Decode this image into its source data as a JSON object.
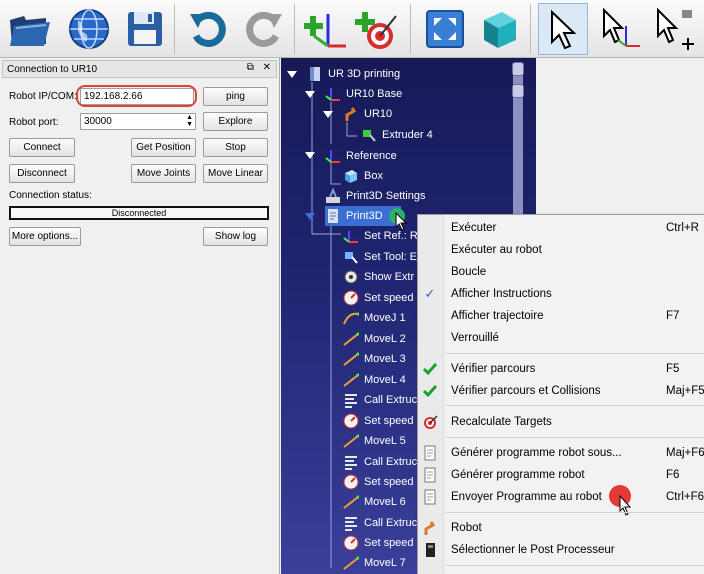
{
  "toolbar": {
    "buttons": [
      {
        "name": "open-icon"
      },
      {
        "name": "globe-icon"
      },
      {
        "name": "save-icon"
      },
      {
        "name": "undo-icon"
      },
      {
        "name": "redo-icon"
      },
      {
        "name": "add-reference-icon"
      },
      {
        "name": "add-target-icon"
      },
      {
        "name": "fit-all-icon"
      },
      {
        "name": "cube-view-icon"
      },
      {
        "name": "select-icon"
      },
      {
        "name": "move-reference-icon"
      },
      {
        "name": "move-tool-icon"
      }
    ]
  },
  "connection_panel": {
    "title": "Connection to UR10",
    "ip_label": "Robot IP/COM:",
    "ip_value": "192.168.2.66",
    "ping_label": "ping",
    "port_label": "Robot port:",
    "port_value": "30000",
    "explore_label": "Explore",
    "connect_label": "Connect",
    "get_position_label": "Get Position",
    "stop_label": "Stop",
    "disconnect_label": "Disconnect",
    "move_joints_label": "Move Joints",
    "move_linear_label": "Move Linear",
    "status_label": "Connection status:",
    "status_value": "Disconnected",
    "more_options_label": "More options...",
    "show_log_label": "Show log"
  },
  "tree": {
    "items": [
      {
        "label": "UR 3D printing"
      },
      {
        "label": "UR10 Base"
      },
      {
        "label": "UR10"
      },
      {
        "label": "Extruder 4"
      },
      {
        "label": "Reference"
      },
      {
        "label": "Box"
      },
      {
        "label": "Print3D Settings"
      },
      {
        "label": "Print3D"
      },
      {
        "label": "Set Ref.: R"
      },
      {
        "label": "Set Tool: E"
      },
      {
        "label": "Show Extr"
      },
      {
        "label": "Set speed"
      },
      {
        "label": "MoveJ 1"
      },
      {
        "label": "MoveL 2"
      },
      {
        "label": "MoveL 3"
      },
      {
        "label": "MoveL 4"
      },
      {
        "label": "Call Extruc"
      },
      {
        "label": "Set speed"
      },
      {
        "label": "MoveL 5"
      },
      {
        "label": "Call Extruc"
      },
      {
        "label": "Set speed"
      },
      {
        "label": "MoveL 6"
      },
      {
        "label": "Call Extruc"
      },
      {
        "label": "Set speed"
      },
      {
        "label": "MoveL 7"
      }
    ]
  },
  "context_menu": {
    "items": [
      {
        "label": "Exécuter",
        "shortcut": "Ctrl+R"
      },
      {
        "label": "Exécuter au robot",
        "shortcut": ""
      },
      {
        "label": "Boucle",
        "shortcut": ""
      },
      {
        "label": "Afficher Instructions",
        "shortcut": "",
        "checked": true
      },
      {
        "label": "Afficher trajectoire",
        "shortcut": "F7"
      },
      {
        "label": "Verrouillé",
        "shortcut": ""
      },
      {
        "label": "Vérifier parcours",
        "shortcut": "F5"
      },
      {
        "label": "Vérifier parcours et Collisions",
        "shortcut": "Maj+F5"
      },
      {
        "label": "Recalculate Targets",
        "shortcut": ""
      },
      {
        "label": "Générer programme robot sous...",
        "shortcut": "Maj+F6"
      },
      {
        "label": "Générer programme robot",
        "shortcut": "F6"
      },
      {
        "label": "Envoyer Programme au robot",
        "shortcut": "Ctrl+F6"
      },
      {
        "label": "Robot",
        "shortcut": ""
      },
      {
        "label": "Sélectionner le Post Processeur",
        "shortcut": ""
      }
    ]
  },
  "colors": {
    "accent": "#3b6fd4",
    "tree_bg": "#1f2470",
    "highlight_ring": "#d9453b",
    "check": "#1aa12a"
  }
}
